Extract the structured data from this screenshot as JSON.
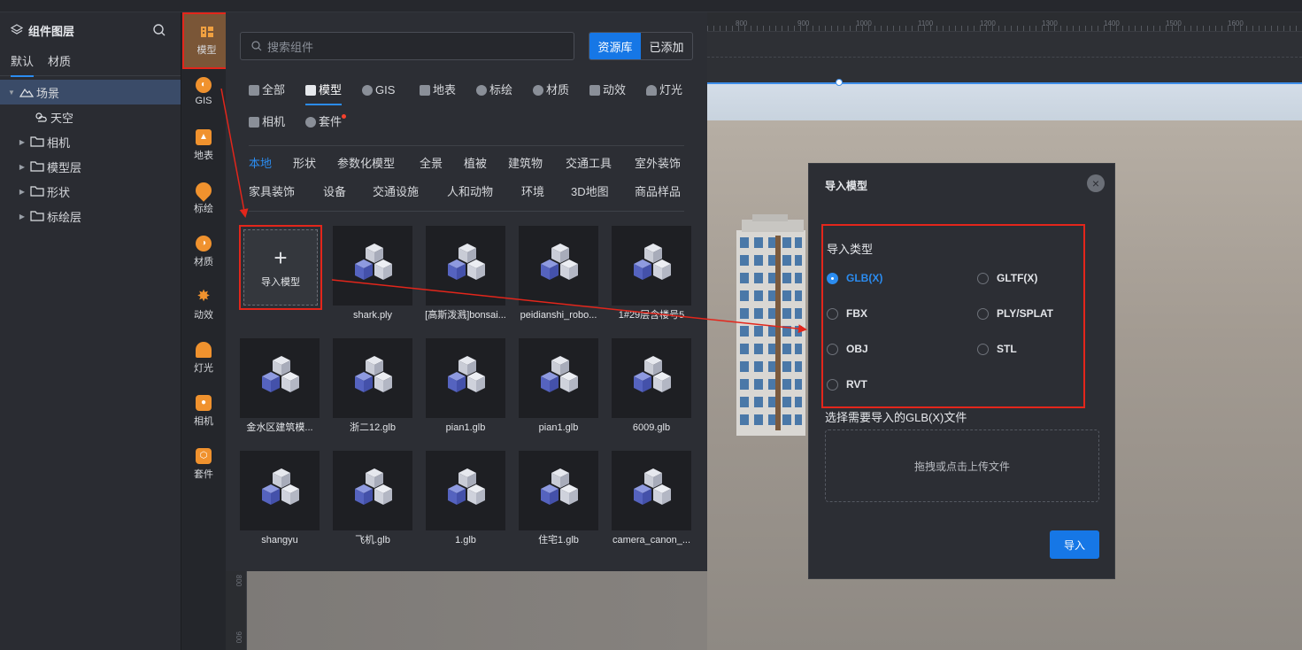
{
  "layer_panel": {
    "title": "组件图层",
    "tabs": [
      "默认",
      "材质"
    ],
    "tree": [
      {
        "label": "场景",
        "expanded": true,
        "selected": true,
        "icon": "scene-icon"
      },
      {
        "label": "天空",
        "icon": "weather-icon"
      },
      {
        "label": "相机",
        "icon": "folder-icon"
      },
      {
        "label": "模型层",
        "icon": "folder-icon"
      },
      {
        "label": "形状",
        "icon": "folder-icon"
      },
      {
        "label": "标绘层",
        "icon": "folder-icon"
      }
    ]
  },
  "categories": [
    {
      "label": "模型",
      "icon": "model-icon"
    },
    {
      "label": "GIS",
      "icon": "gis-icon"
    },
    {
      "label": "地表",
      "icon": "terrain-icon"
    },
    {
      "label": "标绘",
      "icon": "marker-icon"
    },
    {
      "label": "材质",
      "icon": "material-icon"
    },
    {
      "label": "动效",
      "icon": "effect-icon"
    },
    {
      "label": "灯光",
      "icon": "light-icon"
    },
    {
      "label": "相机",
      "icon": "camera-icon"
    },
    {
      "label": "套件",
      "icon": "kit-icon"
    }
  ],
  "library": {
    "search_placeholder": "搜索组件",
    "toggle": [
      "资源库",
      "已添加"
    ],
    "type_tabs": [
      "全部",
      "模型",
      "GIS",
      "地表",
      "标绘",
      "材质",
      "动效",
      "灯光",
      "相机",
      "套件"
    ],
    "sub_tabs": [
      "本地",
      "形状",
      "参数化模型",
      "全景",
      "植被",
      "建筑物",
      "交通工具",
      "室外装饰",
      "家具装饰",
      "设备",
      "交通设施",
      "人和动物",
      "环境",
      "3D地图",
      "商品样品"
    ],
    "import_label": "导入模型",
    "import_plus": "+",
    "items": [
      "shark.ply",
      "[高斯泼溅]bonsai...",
      "peidianshi_robo...",
      "1#29层含楼号5",
      "金水区建筑模...",
      "浙二12.glb",
      "pian1.glb",
      "pian1.glb",
      "6009.glb",
      "shangyu",
      "飞机.glb",
      "1.glb",
      "住宅1.glb",
      "camera_canon_..."
    ]
  },
  "ruler_ticks": [
    "800",
    "900",
    "1000",
    "1100",
    "1200",
    "1300",
    "1400",
    "1500",
    "1600"
  ],
  "ruler_left_ticks": [
    "800",
    "900"
  ],
  "modal": {
    "title": "导入模型",
    "close": "×",
    "type_label": "导入类型",
    "options": [
      "GLB(X)",
      "GLTF(X)",
      "FBX",
      "PLY/SPLAT",
      "OBJ",
      "STL",
      "RVT"
    ],
    "selected": "GLB(X)",
    "select_label": "选择需要导入的GLB(X)文件",
    "dropzone": "拖拽或点击上传文件",
    "import_button": "导入"
  },
  "colors": {
    "accent": "#1677e6",
    "highlight": "#e3261b",
    "active_model_bg": "#7a5637"
  }
}
